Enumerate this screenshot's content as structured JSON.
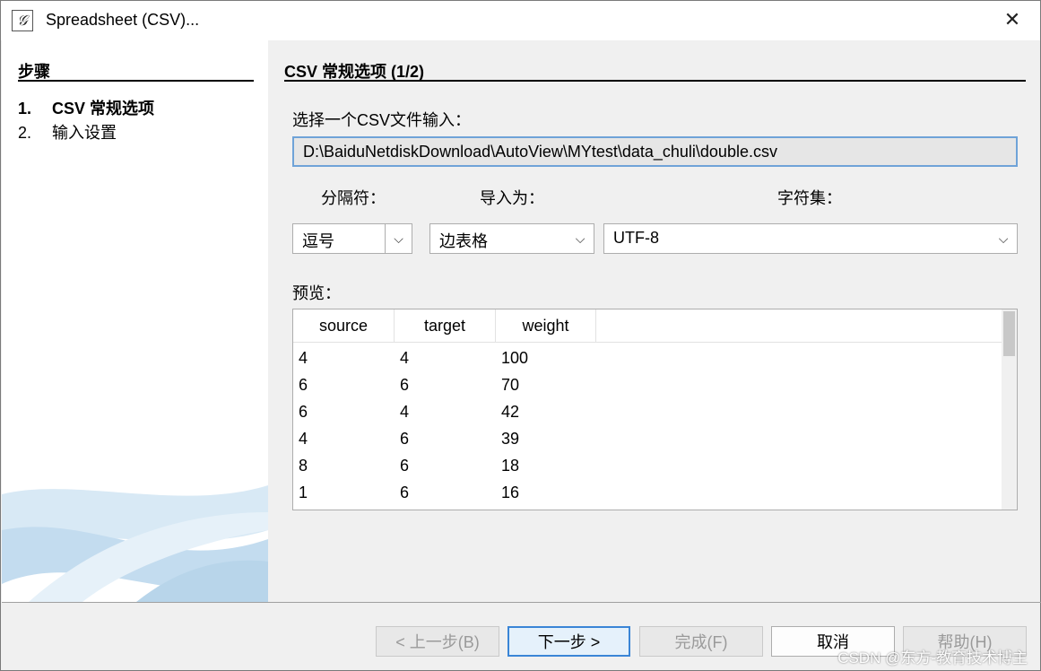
{
  "window": {
    "title": "Spreadsheet (CSV)...",
    "close_glyph": "✕",
    "icon": "app-logo-icon"
  },
  "steps": {
    "title": "步骤",
    "items": [
      {
        "num": "1.",
        "label": "CSV 常规选项",
        "active": true
      },
      {
        "num": "2.",
        "label": "输入设置",
        "active": false
      }
    ]
  },
  "main": {
    "section_title": "CSV 常规选项 (1/2)",
    "file_label": "选择一个CSV文件输入：",
    "file_path": "D:\\BaiduNetdiskDownload\\AutoView\\MYtest\\data_chuli\\double.csv",
    "separator": {
      "label": "分隔符：",
      "value": "逗号"
    },
    "import_as": {
      "label": "导入为：",
      "value": "边表格"
    },
    "charset": {
      "label": "字符集：",
      "value": "UTF-8"
    },
    "preview_label": "预览：",
    "preview": {
      "columns": [
        "source",
        "target",
        "weight"
      ],
      "rows": [
        [
          "4",
          "4",
          "100"
        ],
        [
          "6",
          "6",
          "70"
        ],
        [
          "6",
          "4",
          "42"
        ],
        [
          "4",
          "6",
          "39"
        ],
        [
          "8",
          "6",
          "18"
        ],
        [
          "1",
          "6",
          "16"
        ]
      ]
    }
  },
  "buttons": {
    "back": "< 上一步(B)",
    "next": "下一步 >",
    "finish": "完成(F)",
    "cancel": "取消",
    "help": "帮助(H)"
  },
  "watermark": "CSDN @东方-教育技术博主",
  "colors": {
    "focus_border": "#6fa3d8",
    "default_button": "#3a85d6"
  }
}
